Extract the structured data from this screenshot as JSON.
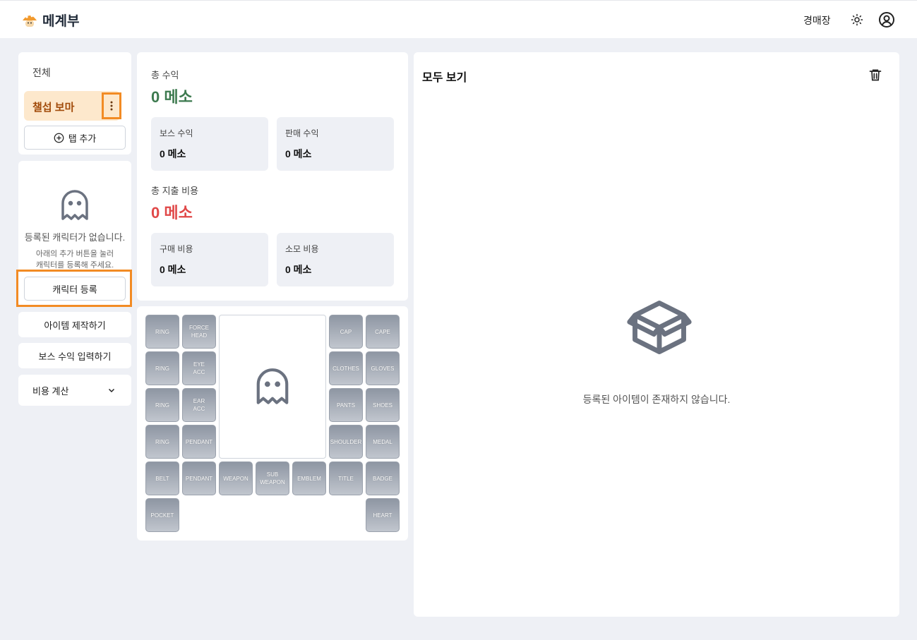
{
  "header": {
    "app_title": "메계부",
    "nav_link": "경매장",
    "icons": [
      "mushroom-logo-icon",
      "sun-icon",
      "user-circle-icon"
    ]
  },
  "sidebar": {
    "tab_all": "전체",
    "active_tab": "챌섭 보마",
    "add_tab": "탭 추가",
    "empty_character_title": "등록된 캐릭터가 없습니다.",
    "empty_character_line1": "아래의 추가 버튼을 눌러",
    "empty_character_line2": "캐릭터를 등록해 주세요.",
    "register_character": "캐릭터 등록",
    "craft_item": "아이템 제작하기",
    "boss_income": "보스 수익 입력하기",
    "cost_calc": "비용 계산"
  },
  "summary": {
    "total_income_label": "총 수익",
    "total_income_value": "0 메소",
    "boss_income_label": "보스 수익",
    "boss_income_value": "0 메소",
    "sale_income_label": "판매 수익",
    "sale_income_value": "0 메소",
    "total_expense_label": "총 지출 비용",
    "total_expense_value": "0 메소",
    "purchase_cost_label": "구매 비용",
    "purchase_cost_value": "0 메소",
    "consume_cost_label": "소모 비용",
    "consume_cost_value": "0 메소",
    "colors": {
      "income": "#3d7a4f",
      "expense": "#e04848"
    }
  },
  "equipment": {
    "left_col1": [
      "RING",
      "RING",
      "RING",
      "RING",
      "BELT",
      "POCKET"
    ],
    "left_col2": [
      "FORCE\nHEAD",
      "EYE\nACC",
      "EAR\nACC",
      "PENDANT",
      "PENDANT"
    ],
    "right_col1": [
      "CAP",
      "CLOTHES",
      "PANTS",
      "SHOULDER",
      "TITLE"
    ],
    "right_col2": [
      "CAPE",
      "GLOVES",
      "SHOES",
      "MEDAL",
      "BADGE",
      "HEART"
    ],
    "bottom_row": [
      "WEAPON",
      "SUB\nWEAPON",
      "EMBLEM"
    ]
  },
  "items_panel": {
    "title": "모두 보기",
    "empty_text": "등록된 아이템이 존재하지 않습니다."
  },
  "accent_color": "#f28b24"
}
